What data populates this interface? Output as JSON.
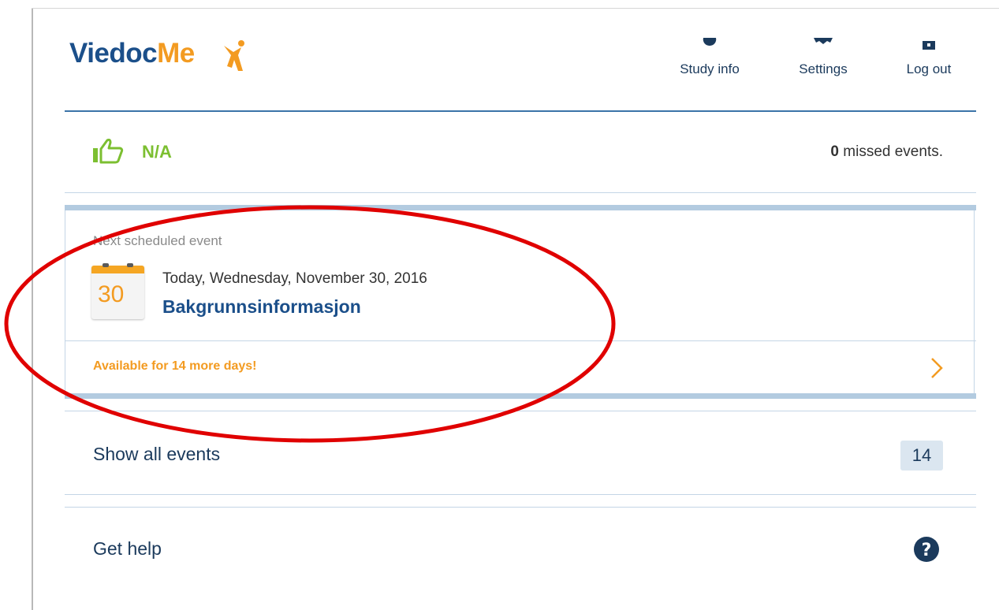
{
  "header": {
    "logo_part1": "Viedoc",
    "logo_part2": "Me",
    "nav": [
      {
        "label": "Study info",
        "icon": "info-icon"
      },
      {
        "label": "Settings",
        "icon": "gear-icon"
      },
      {
        "label": "Log out",
        "icon": "logout-icon"
      }
    ]
  },
  "compliance": {
    "status": "N/A",
    "missed_count": "0",
    "missed_text": " missed events."
  },
  "next_event": {
    "section_label": "Next scheduled event",
    "calendar_day": "30",
    "date": "Today, Wednesday, November 30, 2016",
    "title": "Bakgrunnsinformasjon",
    "availability": "Available for 14 more days!"
  },
  "show_all": {
    "label": "Show all events",
    "count": "14"
  },
  "help": {
    "label": "Get help"
  },
  "colors": {
    "brand_blue": "#1b4f8a",
    "brand_orange": "#f39b21",
    "compliance_green": "#7cbf31",
    "annotation_red": "#e00000"
  }
}
